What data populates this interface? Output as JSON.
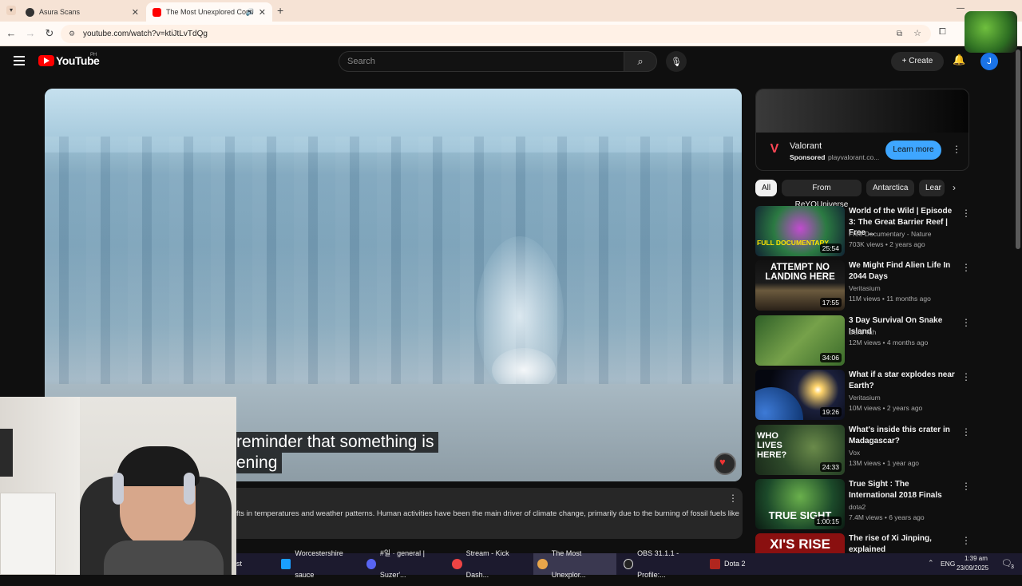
{
  "browser": {
    "tabs": [
      {
        "title": "Asura Scans",
        "active": false
      },
      {
        "title": "The Most Unexplored Conti",
        "active": true
      }
    ],
    "url": "youtube.com/watch?v=ktiJtLvTdQg"
  },
  "youtube": {
    "logo_text": "YouTube",
    "region": "PH",
    "search_placeholder": "Search",
    "create_label": "Create",
    "avatar_letter": "J"
  },
  "player": {
    "caption_line1": "reminder that something is",
    "caption_line2": "ening"
  },
  "description": {
    "text": "fts in temperatures and weather patterns. Human activities have been the main driver of climate change, primarily due to the burning of fossil fuels like"
  },
  "ad": {
    "name": "Valorant",
    "sponsored": "Sponsored",
    "domain": "playvalorant.co...",
    "cta": "Learn more"
  },
  "chips": [
    "All",
    "From ReYOUniverse",
    "Antarctica",
    "Lear"
  ],
  "recommendations": [
    {
      "title": "World of the Wild | Episode 3: The Great Barrier Reef | Free ...",
      "channel": "Free Documentary - Nature",
      "meta": "703K views • 2 years ago",
      "duration": "25:54",
      "thumb_text": "FULL DOCUMENTARY"
    },
    {
      "title": "We Might Find Alien Life In 2044 Days",
      "channel": "Veritasium",
      "meta": "11M views • 11 months ago",
      "duration": "17:55",
      "thumb_text": "ATTEMPT NO LANDING HERE"
    },
    {
      "title": "3 Day Survival On Snake Island",
      "channel": "Dara Tah",
      "meta": "12M views • 4 months ago",
      "duration": "34:06",
      "thumb_text": ""
    },
    {
      "title": "What if a star explodes near Earth?",
      "channel": "Veritasium",
      "meta": "10M views • 2 years ago",
      "duration": "19:26",
      "thumb_text": ""
    },
    {
      "title": "What's inside this crater in Madagascar?",
      "channel": "Vox",
      "meta": "13M views • 1 year ago",
      "duration": "24:33",
      "thumb_text": "WHO LIVES HERE?"
    },
    {
      "title": "True Sight : The International 2018 Finals",
      "channel": "dota2",
      "meta": "7.4M views • 6 years ago",
      "duration": "1:00:15",
      "thumb_text": "TRUE SIGHT"
    },
    {
      "title": "The rise of Xi Jinping, explained",
      "channel": "",
      "meta": "",
      "duration": "",
      "thumb_text": "XI'S RISE"
    }
  ],
  "taskbar": {
    "items": [
      "st",
      "Worcestershire sauce",
      "#일 · general | Suzer'...",
      "Stream - Kick Dash...",
      "The Most Unexplor...",
      "OBS 31.1.1 - Profile:...",
      "Dota 2"
    ],
    "lang": "ENG",
    "time": "1:39 am",
    "date": "23/09/2025",
    "notif_count": "3"
  },
  "colors": {
    "yt_red": "#ff0000",
    "accent_blue": "#3ea6ff",
    "background": "#0f0f0f"
  }
}
